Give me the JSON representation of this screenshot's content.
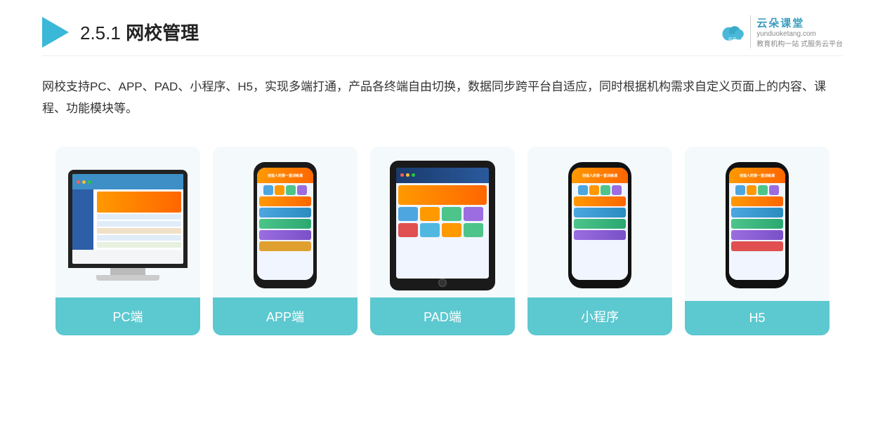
{
  "header": {
    "title_prefix": "2.5.1 ",
    "title_bold": "网校管理",
    "brand_name": "云朵课堂",
    "brand_url": "yunduoketang.com",
    "brand_tagline_line1": "教育机构一站",
    "brand_tagline_line2": "式服务云平台"
  },
  "description": {
    "text": "网校支持PC、APP、PAD、小程序、H5，实现多端打通，产品各终端自由切换，数据同步跨平台自适应，同时根据机构需求自定义页面上的内容、课程、功能模块等。"
  },
  "cards": [
    {
      "label": "PC端"
    },
    {
      "label": "APP端"
    },
    {
      "label": "PAD端"
    },
    {
      "label": "小程序"
    },
    {
      "label": "H5"
    }
  ]
}
